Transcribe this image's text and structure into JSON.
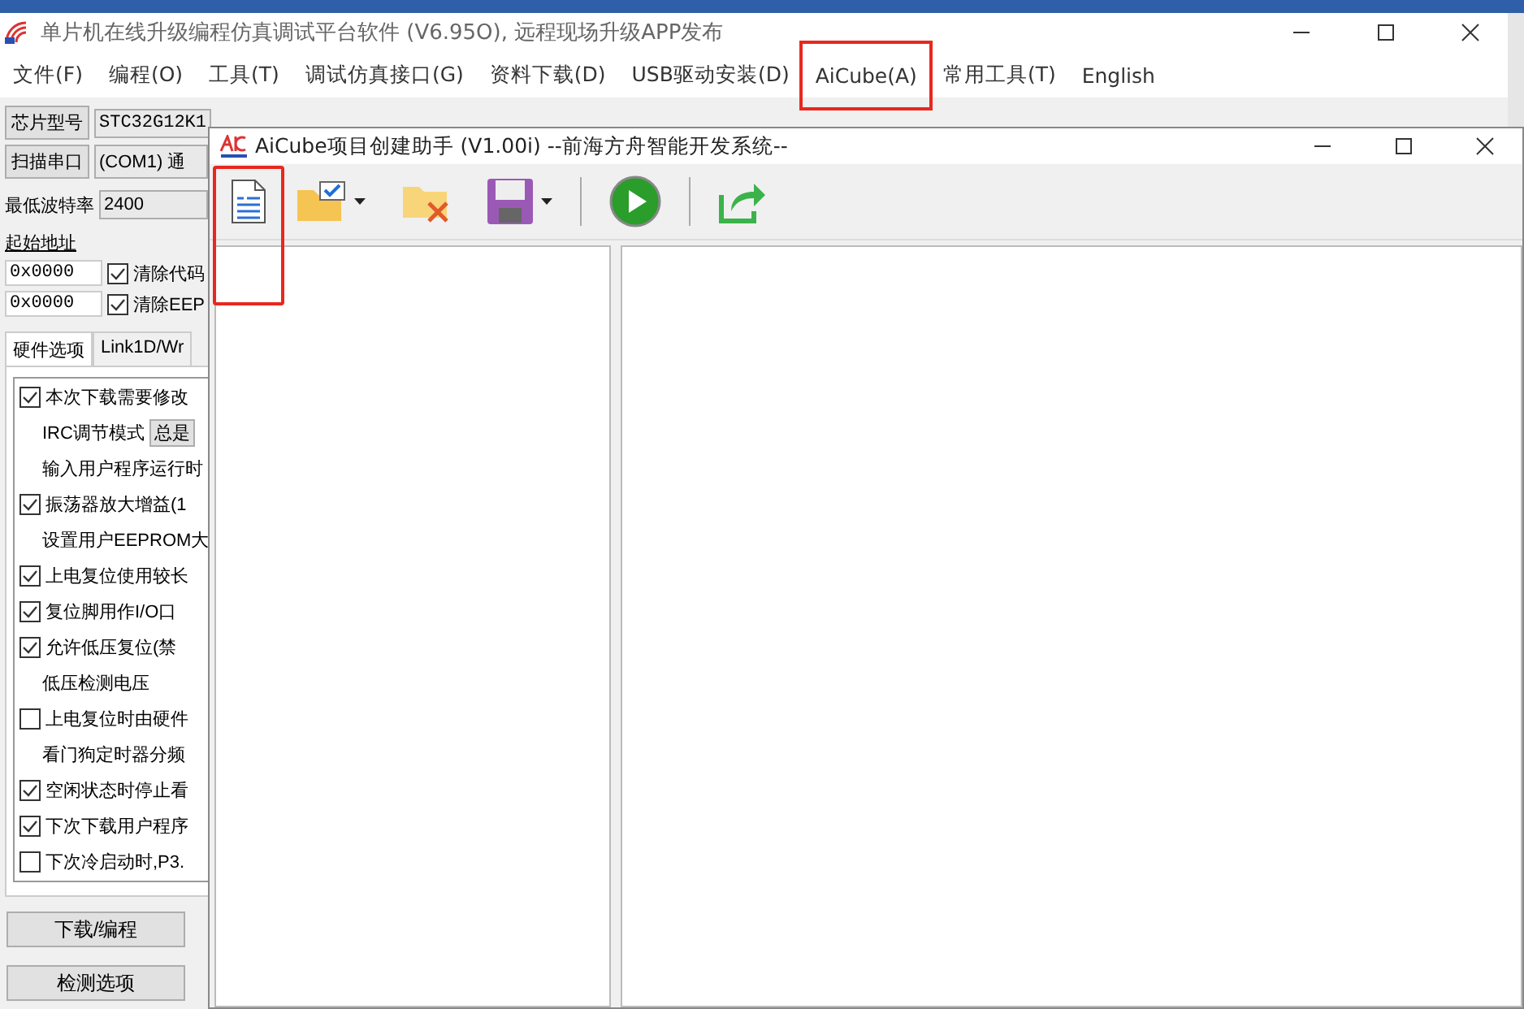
{
  "main_window": {
    "title": "单片机在线升级编程仿真调试平台软件 (V6.95O), 远程现场升级APP发布",
    "menu": [
      {
        "label": "文件(F)",
        "highlighted": false
      },
      {
        "label": "编程(O)",
        "highlighted": false
      },
      {
        "label": "工具(T)",
        "highlighted": false
      },
      {
        "label": "调试仿真接口(G)",
        "highlighted": false
      },
      {
        "label": "资料下载(D)",
        "highlighted": false
      },
      {
        "label": "USB驱动安装(D)",
        "highlighted": false
      },
      {
        "label": "AiCube(A)",
        "highlighted": true
      },
      {
        "label": "常用工具(T)",
        "highlighted": false
      },
      {
        "label": "English",
        "highlighted": false
      }
    ],
    "chip_model": {
      "button": "芯片型号",
      "value": "STC32G12K1"
    },
    "scan_port": {
      "button": "扫描串口",
      "value": "(COM1) 通"
    },
    "baud": {
      "label": "最低波特率",
      "value": "2400"
    },
    "start_address": "起始地址",
    "address_rows": [
      {
        "value": "0x0000",
        "label": "清除代码",
        "checked": true
      },
      {
        "value": "0x0000",
        "label": "清除EEP",
        "checked": true
      }
    ],
    "tabs": [
      {
        "label": "硬件选项",
        "selected": true
      },
      {
        "label": "Link1D/Wr",
        "selected": false
      }
    ],
    "options": [
      {
        "kind": "checkbox",
        "label": "本次下载需要修改",
        "checked": true
      },
      {
        "kind": "select",
        "label": "IRC调节模式",
        "value": "总是"
      },
      {
        "kind": "text",
        "label": "输入用户程序运行时"
      },
      {
        "kind": "checkbox",
        "label": "振荡器放大增益(1",
        "checked": true
      },
      {
        "kind": "text",
        "label": "设置用户EEPROM大"
      },
      {
        "kind": "checkbox",
        "label": "上电复位使用较长",
        "checked": true
      },
      {
        "kind": "checkbox",
        "label": "复位脚用作I/O口",
        "checked": true
      },
      {
        "kind": "checkbox",
        "label": "允许低压复位(禁",
        "checked": true
      },
      {
        "kind": "text",
        "label": "低压检测电压"
      },
      {
        "kind": "checkbox",
        "label": "上电复位时由硬件",
        "checked": false
      },
      {
        "kind": "text",
        "label": "看门狗定时器分频"
      },
      {
        "kind": "checkbox",
        "label": "空闲状态时停止看",
        "checked": true
      },
      {
        "kind": "checkbox",
        "label": "下次下载用户程序",
        "checked": true
      },
      {
        "kind": "checkbox",
        "label": "下次冷启动时,P3.",
        "checked": false
      }
    ],
    "buttons": [
      "下载/编程",
      "检测选项"
    ]
  },
  "dialog": {
    "title": "AiCube项目创建助手 (V1.00i) --前海方舟智能开发系统--",
    "toolbar": [
      {
        "kind": "document",
        "dropdown": false,
        "highlighted": true
      },
      {
        "kind": "folder-check",
        "dropdown": true,
        "highlighted": false
      },
      {
        "kind": "folder-delete",
        "dropdown": false,
        "highlighted": false
      },
      {
        "kind": "save",
        "dropdown": true,
        "highlighted": false
      },
      {
        "kind": "separator"
      },
      {
        "kind": "run",
        "dropdown": false,
        "highlighted": false
      },
      {
        "kind": "separator"
      },
      {
        "kind": "export",
        "dropdown": false,
        "highlighted": false
      }
    ]
  }
}
